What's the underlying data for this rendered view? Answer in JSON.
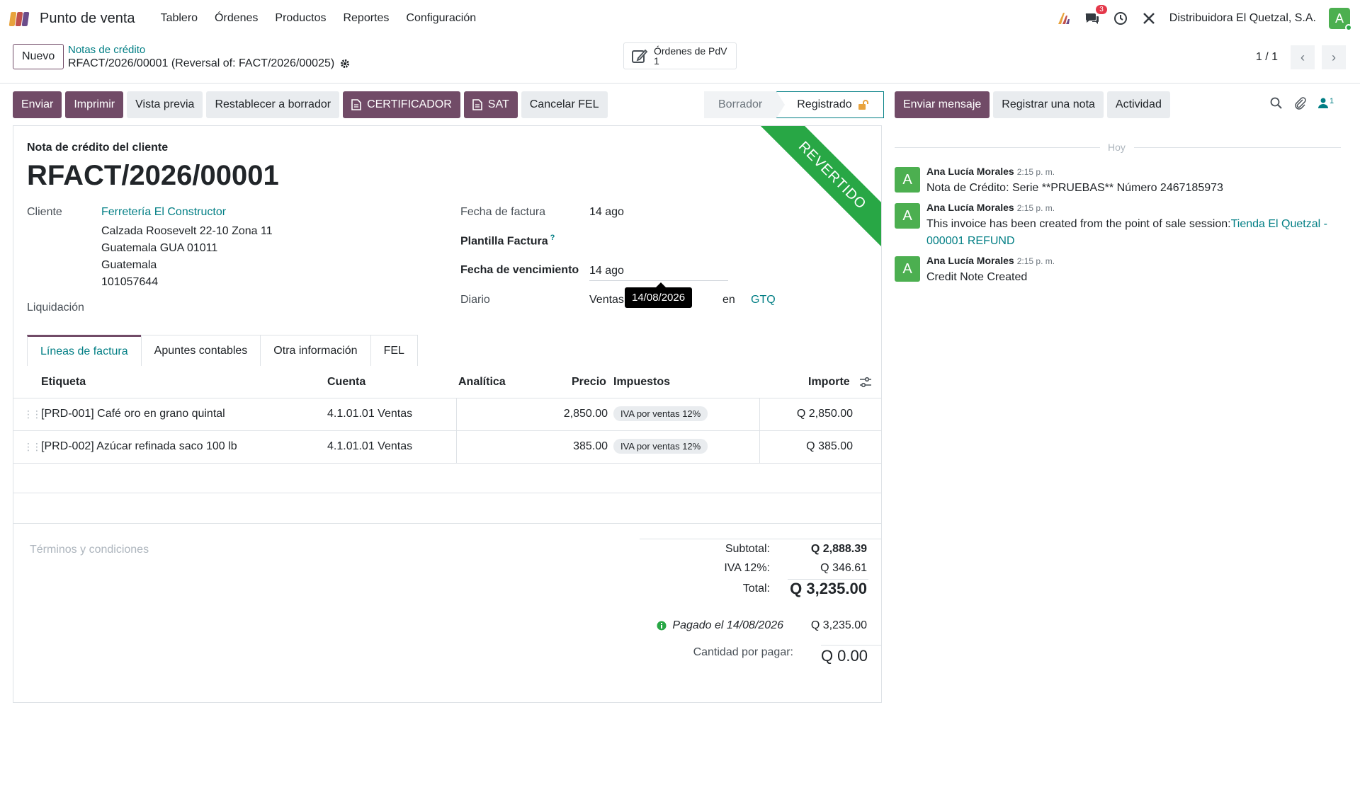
{
  "app": {
    "name": "Punto de venta",
    "menu": [
      "Tablero",
      "Órdenes",
      "Productos",
      "Reportes",
      "Configuración"
    ],
    "messages_count": "3",
    "company": "Distribuidora El Quetzal, S.A.",
    "user_initial": "A"
  },
  "control": {
    "new_label": "Nuevo",
    "breadcrumb_parent": "Notas de crédito",
    "breadcrumb_current": "RFACT/2026/00001 (Reversal of: FACT/2026/00025)",
    "smart_button_label": "Órdenes de PdV",
    "smart_button_count": "1",
    "pager": "1 / 1"
  },
  "actions": {
    "send": "Enviar",
    "print": "Imprimir",
    "preview": "Vista previa",
    "reset_draft": "Restablecer a borrador",
    "certificador": "CERTIFICADOR",
    "sat": "SAT",
    "cancel_fel": "Cancelar FEL"
  },
  "status": {
    "draft": "Borrador",
    "posted": "Registrado"
  },
  "invoice": {
    "ribbon": "REVERTIDO",
    "doc_type": "Nota de crédito del cliente",
    "number": "RFACT/2026/00001",
    "customer_label": "Cliente",
    "customer_name": "Ferretería El Constructor",
    "address": [
      "Calzada Roosevelt 22-10 Zona 11",
      "Guatemala GUA 01011",
      "Guatemala",
      "101057644"
    ],
    "liquidation_label": "Liquidación",
    "invoice_date_label": "Fecha de factura",
    "invoice_date": "14 ago",
    "template_label": "Plantilla Factura",
    "template_help": "?",
    "due_date_label": "Fecha de vencimiento",
    "due_date": "14 ago",
    "tooltip": "14/08/2026",
    "journal_label": "Diario",
    "journal": "Ventas",
    "currency_in": "en",
    "currency": "GTQ"
  },
  "tabs": [
    "Líneas de factura",
    "Apuntes contables",
    "Otra información",
    "FEL"
  ],
  "lines": {
    "headers": {
      "label": "Etiqueta",
      "account": "Cuenta",
      "analytic": "Analítica",
      "price": "Precio",
      "taxes": "Impuestos",
      "amount": "Importe"
    },
    "rows": [
      {
        "label": "[PRD-001] Café oro en grano quintal",
        "account": "4.1.01.01 Ventas",
        "price": "2,850.00",
        "tax": "IVA por ventas 12%",
        "amount": "Q 2,850.00"
      },
      {
        "label": "[PRD-002] Azúcar refinada saco 100 lb",
        "account": "4.1.01.01 Ventas",
        "price": "385.00",
        "tax": "IVA por ventas 12%",
        "amount": "Q 385.00"
      }
    ]
  },
  "terms_placeholder": "Términos y condiciones",
  "totals": {
    "subtotal_label": "Subtotal:",
    "subtotal": "Q 2,888.39",
    "iva_label": "IVA 12%:",
    "iva": "Q 346.61",
    "total_label": "Total:",
    "total": "Q 3,235.00",
    "paid_label": "Pagado el 14/08/2026",
    "paid": "Q 3,235.00",
    "due_label": "Cantidad por pagar:",
    "due": "Q 0.00"
  },
  "chatter": {
    "send_message": "Enviar mensaje",
    "log_note": "Registrar una nota",
    "activity": "Actividad",
    "followers_count": "1",
    "today": "Hoy",
    "messages": [
      {
        "author": "Ana Lucía Morales",
        "time": "2:15 p. m.",
        "body": "Nota de Crédito: Serie **PRUEBAS** Número 2467185973",
        "link": ""
      },
      {
        "author": "Ana Lucía Morales",
        "time": "2:15 p. m.",
        "body": "This invoice has been created from the point of sale session:",
        "link": "Tienda El Quetzal - 000001 REFUND"
      },
      {
        "author": "Ana Lucía Morales",
        "time": "2:15 p. m.",
        "body": "Credit Note Created",
        "link": ""
      }
    ]
  }
}
